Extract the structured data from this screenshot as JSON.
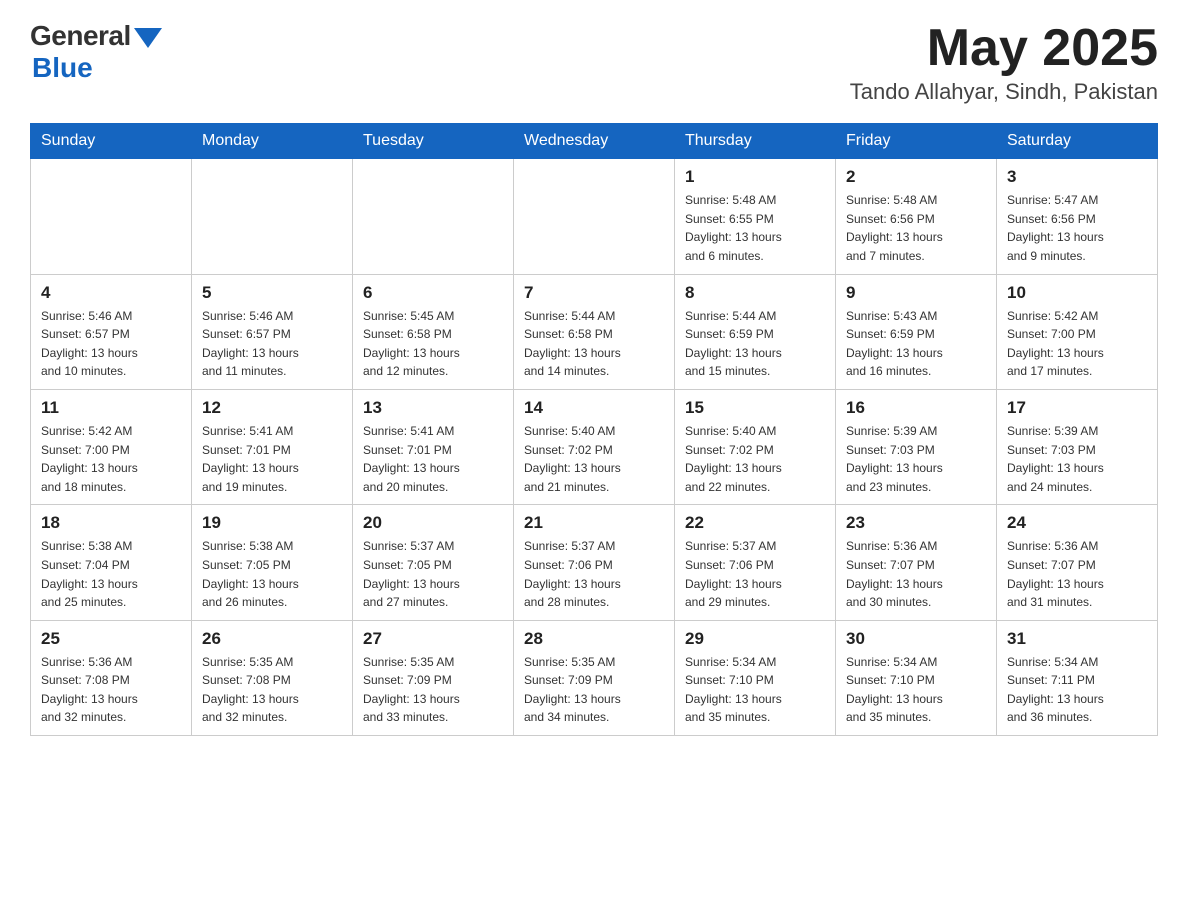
{
  "header": {
    "logo_general": "General",
    "logo_blue": "Blue",
    "month_year": "May 2025",
    "location": "Tando Allahyar, Sindh, Pakistan"
  },
  "days_of_week": [
    "Sunday",
    "Monday",
    "Tuesday",
    "Wednesday",
    "Thursday",
    "Friday",
    "Saturday"
  ],
  "weeks": [
    [
      {
        "day": "",
        "info": ""
      },
      {
        "day": "",
        "info": ""
      },
      {
        "day": "",
        "info": ""
      },
      {
        "day": "",
        "info": ""
      },
      {
        "day": "1",
        "info": "Sunrise: 5:48 AM\nSunset: 6:55 PM\nDaylight: 13 hours\nand 6 minutes."
      },
      {
        "day": "2",
        "info": "Sunrise: 5:48 AM\nSunset: 6:56 PM\nDaylight: 13 hours\nand 7 minutes."
      },
      {
        "day": "3",
        "info": "Sunrise: 5:47 AM\nSunset: 6:56 PM\nDaylight: 13 hours\nand 9 minutes."
      }
    ],
    [
      {
        "day": "4",
        "info": "Sunrise: 5:46 AM\nSunset: 6:57 PM\nDaylight: 13 hours\nand 10 minutes."
      },
      {
        "day": "5",
        "info": "Sunrise: 5:46 AM\nSunset: 6:57 PM\nDaylight: 13 hours\nand 11 minutes."
      },
      {
        "day": "6",
        "info": "Sunrise: 5:45 AM\nSunset: 6:58 PM\nDaylight: 13 hours\nand 12 minutes."
      },
      {
        "day": "7",
        "info": "Sunrise: 5:44 AM\nSunset: 6:58 PM\nDaylight: 13 hours\nand 14 minutes."
      },
      {
        "day": "8",
        "info": "Sunrise: 5:44 AM\nSunset: 6:59 PM\nDaylight: 13 hours\nand 15 minutes."
      },
      {
        "day": "9",
        "info": "Sunrise: 5:43 AM\nSunset: 6:59 PM\nDaylight: 13 hours\nand 16 minutes."
      },
      {
        "day": "10",
        "info": "Sunrise: 5:42 AM\nSunset: 7:00 PM\nDaylight: 13 hours\nand 17 minutes."
      }
    ],
    [
      {
        "day": "11",
        "info": "Sunrise: 5:42 AM\nSunset: 7:00 PM\nDaylight: 13 hours\nand 18 minutes."
      },
      {
        "day": "12",
        "info": "Sunrise: 5:41 AM\nSunset: 7:01 PM\nDaylight: 13 hours\nand 19 minutes."
      },
      {
        "day": "13",
        "info": "Sunrise: 5:41 AM\nSunset: 7:01 PM\nDaylight: 13 hours\nand 20 minutes."
      },
      {
        "day": "14",
        "info": "Sunrise: 5:40 AM\nSunset: 7:02 PM\nDaylight: 13 hours\nand 21 minutes."
      },
      {
        "day": "15",
        "info": "Sunrise: 5:40 AM\nSunset: 7:02 PM\nDaylight: 13 hours\nand 22 minutes."
      },
      {
        "day": "16",
        "info": "Sunrise: 5:39 AM\nSunset: 7:03 PM\nDaylight: 13 hours\nand 23 minutes."
      },
      {
        "day": "17",
        "info": "Sunrise: 5:39 AM\nSunset: 7:03 PM\nDaylight: 13 hours\nand 24 minutes."
      }
    ],
    [
      {
        "day": "18",
        "info": "Sunrise: 5:38 AM\nSunset: 7:04 PM\nDaylight: 13 hours\nand 25 minutes."
      },
      {
        "day": "19",
        "info": "Sunrise: 5:38 AM\nSunset: 7:05 PM\nDaylight: 13 hours\nand 26 minutes."
      },
      {
        "day": "20",
        "info": "Sunrise: 5:37 AM\nSunset: 7:05 PM\nDaylight: 13 hours\nand 27 minutes."
      },
      {
        "day": "21",
        "info": "Sunrise: 5:37 AM\nSunset: 7:06 PM\nDaylight: 13 hours\nand 28 minutes."
      },
      {
        "day": "22",
        "info": "Sunrise: 5:37 AM\nSunset: 7:06 PM\nDaylight: 13 hours\nand 29 minutes."
      },
      {
        "day": "23",
        "info": "Sunrise: 5:36 AM\nSunset: 7:07 PM\nDaylight: 13 hours\nand 30 minutes."
      },
      {
        "day": "24",
        "info": "Sunrise: 5:36 AM\nSunset: 7:07 PM\nDaylight: 13 hours\nand 31 minutes."
      }
    ],
    [
      {
        "day": "25",
        "info": "Sunrise: 5:36 AM\nSunset: 7:08 PM\nDaylight: 13 hours\nand 32 minutes."
      },
      {
        "day": "26",
        "info": "Sunrise: 5:35 AM\nSunset: 7:08 PM\nDaylight: 13 hours\nand 32 minutes."
      },
      {
        "day": "27",
        "info": "Sunrise: 5:35 AM\nSunset: 7:09 PM\nDaylight: 13 hours\nand 33 minutes."
      },
      {
        "day": "28",
        "info": "Sunrise: 5:35 AM\nSunset: 7:09 PM\nDaylight: 13 hours\nand 34 minutes."
      },
      {
        "day": "29",
        "info": "Sunrise: 5:34 AM\nSunset: 7:10 PM\nDaylight: 13 hours\nand 35 minutes."
      },
      {
        "day": "30",
        "info": "Sunrise: 5:34 AM\nSunset: 7:10 PM\nDaylight: 13 hours\nand 35 minutes."
      },
      {
        "day": "31",
        "info": "Sunrise: 5:34 AM\nSunset: 7:11 PM\nDaylight: 13 hours\nand 36 minutes."
      }
    ]
  ]
}
